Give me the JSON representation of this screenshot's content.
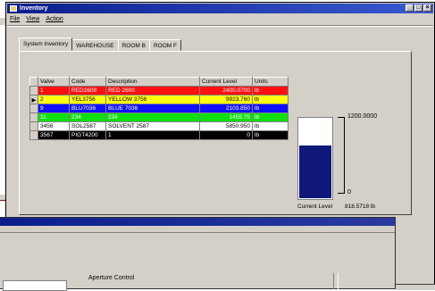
{
  "window": {
    "title": "Inventory"
  },
  "menu": [
    "File",
    "View",
    "Action"
  ],
  "tabs": [
    "System Inventory",
    "WAREHOUSE",
    "ROOM B",
    "ROOM F"
  ],
  "grid": {
    "headers": [
      "Valve",
      "Code",
      "Description",
      "Current Level",
      "Units"
    ],
    "rows": [
      {
        "valve": "1",
        "code": "RED2600",
        "description": "RED 2600",
        "level": "2400.0700",
        "units": "lb",
        "bg": "#ff1010",
        "fg": "#ffffff",
        "selected": false
      },
      {
        "valve": "2",
        "code": "YEL3756",
        "description": "YELLOW 3756",
        "level": "9923.760",
        "units": "lb",
        "bg": "#ffff10",
        "fg": "#000000",
        "selected": true
      },
      {
        "valve": "9",
        "code": "BLU7036",
        "description": "BLUE 7036",
        "level": "2103.850",
        "units": "lb",
        "bg": "#1010ff",
        "fg": "#ffffff",
        "selected": false
      },
      {
        "valve": "11",
        "code": "234",
        "description": "234",
        "level": "1455.75",
        "units": "lb",
        "bg": "#10e010",
        "fg": "#ffffff",
        "selected": false
      },
      {
        "valve": "3456",
        "code": "SOL2587",
        "description": "SOLVENT 2587",
        "level": "5850.950",
        "units": "lb",
        "bg": "#ffffff",
        "fg": "#000000",
        "selected": false
      },
      {
        "valve": "3567",
        "code": "PIGT4200",
        "description": "1",
        "level": "0",
        "units": "lb",
        "bg": "#000000",
        "fg": "#ffffff",
        "selected": false
      }
    ]
  },
  "gauge": {
    "max_label": "1200.0000",
    "min_label": "0",
    "fill_fraction": 0.66,
    "caption": "Current Level",
    "current_value": "818.5718 lb"
  },
  "back_window": {
    "label": "Aperture Control"
  }
}
